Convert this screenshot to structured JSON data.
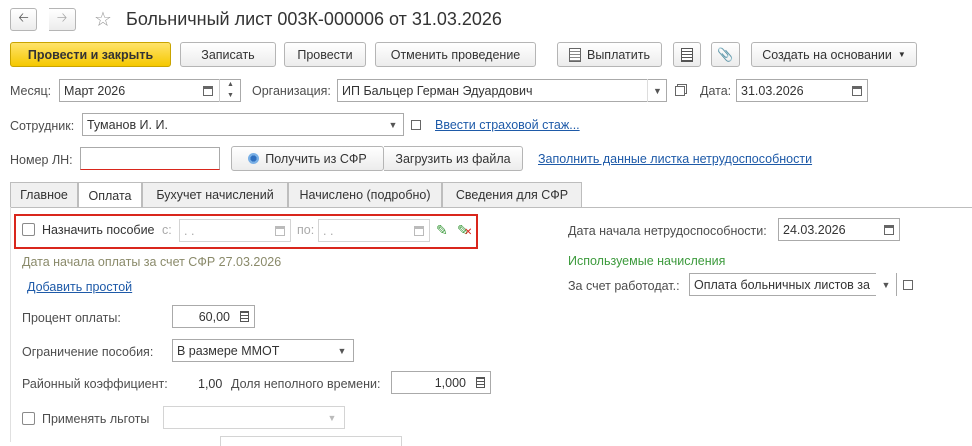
{
  "title": "Больничный лист 003К-000006 от 31.03.2026",
  "toolbar": {
    "post_close": "Провести и закрыть",
    "save": "Записать",
    "post": "Провести",
    "unpost": "Отменить проведение",
    "pay": "Выплатить",
    "create_based": "Создать на основании"
  },
  "header": {
    "month_label": "Месяц:",
    "month_value": "Март 2026",
    "org_label": "Организация:",
    "org_value": "ИП Бальцер Герман Эдуардович",
    "date_label": "Дата:",
    "date_value": "31.03.2026",
    "employee_label": "Сотрудник:",
    "employee_value": "Туманов И. И.",
    "insurance_link": "Ввести страховой стаж...",
    "ln_label": "Номер ЛН:",
    "ln_value": "",
    "get_sfr": "Получить из СФР",
    "load_file": "Загрузить из файла",
    "fill_link": "Заполнить данные листка нетрудоспособности"
  },
  "tabs": [
    "Главное",
    "Оплата",
    "Бухучет начислений",
    "Начислено (подробно)",
    "Сведения для СФР"
  ],
  "active_tab": 1,
  "pay": {
    "assign_label": "Назначить пособие",
    "from_label": "с:",
    "from_value": " .  .",
    "to_label": "по:",
    "to_value": " .  .",
    "pay_start_note": "Дата начала оплаты за счет СФР 27.03.2026",
    "add_simple": "Добавить простой",
    "percent_label": "Процент оплаты:",
    "percent_value": "60,00",
    "limit_label": "Ограничение пособия:",
    "limit_value": "В размере ММОТ",
    "district_label": "Районный коэффициент:",
    "district_value": "1,00",
    "part_time_label": "Доля неполного времени:",
    "part_time_value": "1,000",
    "benefits_label": "Применять льготы",
    "disability_start_label": "Дата начала нетрудоспособности:",
    "disability_start_value": "24.03.2026",
    "used_accruals": "Используемые начисления",
    "employer_label": "За счет работодат.:",
    "employer_value": "Оплата больничных листов за"
  },
  "colors": {
    "primary_button": "#f5c800",
    "highlight_border": "#d9261c",
    "green_text": "#3c9a3c",
    "link": "#1e5aa8"
  }
}
